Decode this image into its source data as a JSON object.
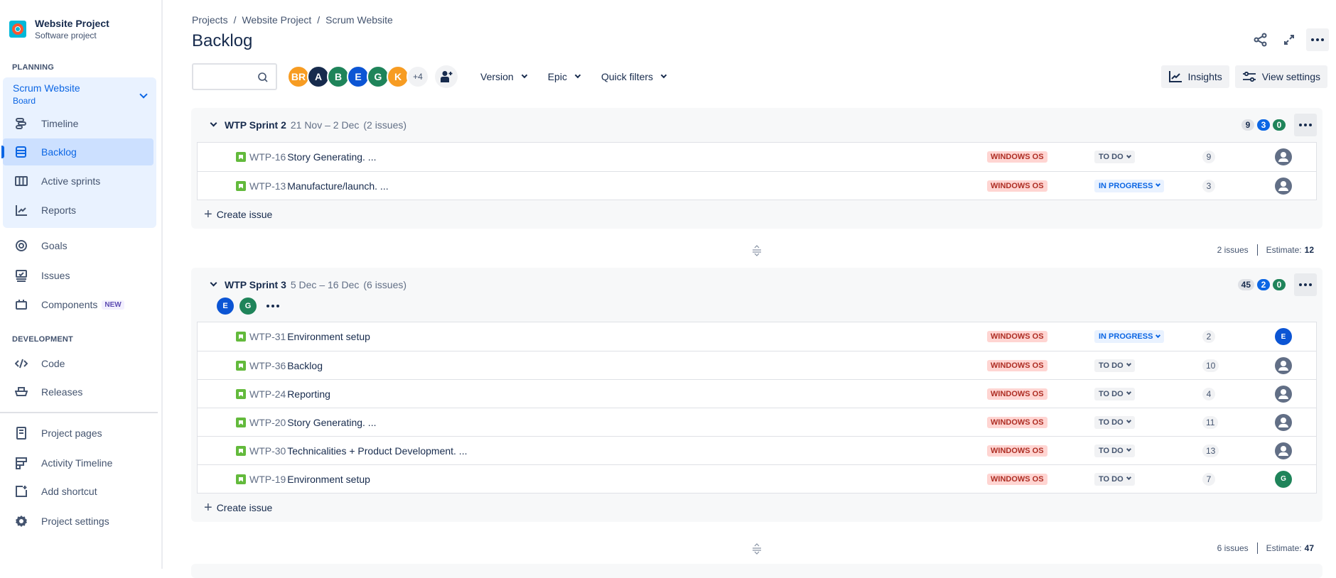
{
  "project": {
    "name": "Website Project",
    "type": "Software project",
    "logo_color": "#00b8d9"
  },
  "sidebar": {
    "planning_heading": "PLANNING",
    "board": {
      "name": "Scrum Website",
      "type": "Board"
    },
    "board_items": [
      {
        "label": "Timeline",
        "icon": "timeline-icon",
        "active": false
      },
      {
        "label": "Backlog",
        "icon": "backlog-icon",
        "active": true
      },
      {
        "label": "Active sprints",
        "icon": "board-columns-icon",
        "active": false
      },
      {
        "label": "Reports",
        "icon": "reports-chart-icon",
        "active": false
      }
    ],
    "items": [
      {
        "label": "Goals",
        "icon": "goals-target-icon"
      },
      {
        "label": "Issues",
        "icon": "issues-icon"
      },
      {
        "label": "Components",
        "icon": "components-icon",
        "badge": "NEW"
      }
    ],
    "development_heading": "DEVELOPMENT",
    "dev_items": [
      {
        "label": "Code",
        "icon": "code-icon"
      },
      {
        "label": "Releases",
        "icon": "releases-ship-icon"
      }
    ],
    "bottom_items": [
      {
        "label": "Project pages",
        "icon": "page-icon"
      },
      {
        "label": "Activity Timeline",
        "icon": "activity-timeline-icon"
      },
      {
        "label": "Add shortcut",
        "icon": "add-shortcut-icon"
      },
      {
        "label": "Project settings",
        "icon": "gear-icon"
      }
    ]
  },
  "breadcrumbs": [
    "Projects",
    "Website Project",
    "Scrum Website"
  ],
  "page_title": "Backlog",
  "toolbar": {
    "search_value": "",
    "search_placeholder": "",
    "avatars": [
      {
        "initials": "BR",
        "color": "#f79c22"
      },
      {
        "initials": "A",
        "color": "#172b4d"
      },
      {
        "initials": "B",
        "color": "#1f845a"
      },
      {
        "initials": "E",
        "color": "#0c55d4"
      },
      {
        "initials": "G",
        "color": "#1f845a"
      },
      {
        "initials": "K",
        "color": "#f79c22"
      }
    ],
    "more_avatars": "+4",
    "filters": [
      "Version",
      "Epic",
      "Quick filters"
    ],
    "insights_label": "Insights",
    "view_settings_label": "View settings"
  },
  "sprints": [
    {
      "name": "WTP Sprint 2",
      "dates": "21 Nov – 2 Dec",
      "issue_count_label": "(2 issues)",
      "counts": {
        "todo": "9",
        "in_progress": "3",
        "done": "0"
      },
      "assignees": [],
      "issues": [
        {
          "key": "WTP-16",
          "summary": "Story Generating. ...",
          "epic": "WINDOWS OS",
          "status": "TO DO",
          "status_type": "todo",
          "estimate": "9",
          "assignee": null
        },
        {
          "key": "WTP-13",
          "summary": "Manufacture/launch. ...",
          "epic": "WINDOWS OS",
          "status": "IN PROGRESS",
          "status_type": "prog",
          "estimate": "3",
          "assignee": null
        }
      ],
      "create_label": "Create issue",
      "footer": {
        "issues": "2 issues",
        "estimate_label": "Estimate:",
        "estimate": "12"
      }
    },
    {
      "name": "WTP Sprint 3",
      "dates": "5 Dec – 16 Dec",
      "issue_count_label": "(6 issues)",
      "counts": {
        "todo": "45",
        "in_progress": "2",
        "done": "0"
      },
      "assignees": [
        {
          "initials": "E",
          "color": "#0c55d4"
        },
        {
          "initials": "G",
          "color": "#1f845a"
        }
      ],
      "issues": [
        {
          "key": "WTP-31",
          "summary": "Environment setup",
          "epic": "WINDOWS OS",
          "status": "IN PROGRESS",
          "status_type": "prog",
          "estimate": "2",
          "assignee": {
            "initials": "E",
            "color": "#0c55d4"
          }
        },
        {
          "key": "WTP-36",
          "summary": "Backlog",
          "epic": "WINDOWS OS",
          "status": "TO DO",
          "status_type": "todo",
          "estimate": "10",
          "assignee": null
        },
        {
          "key": "WTP-24",
          "summary": "Reporting",
          "epic": "WINDOWS OS",
          "status": "TO DO",
          "status_type": "todo",
          "estimate": "4",
          "assignee": null
        },
        {
          "key": "WTP-20",
          "summary": "Story Generating. ...",
          "epic": "WINDOWS OS",
          "status": "TO DO",
          "status_type": "todo",
          "estimate": "11",
          "assignee": null
        },
        {
          "key": "WTP-30",
          "summary": "Technicalities + Product Development. ...",
          "epic": "WINDOWS OS",
          "status": "TO DO",
          "status_type": "todo",
          "estimate": "13",
          "assignee": null
        },
        {
          "key": "WTP-19",
          "summary": "Environment setup",
          "epic": "WINDOWS OS",
          "status": "TO DO",
          "status_type": "todo",
          "estimate": "7",
          "assignee": {
            "initials": "G",
            "color": "#1f845a"
          }
        }
      ],
      "create_label": "Create issue",
      "footer": {
        "issues": "6 issues",
        "estimate_label": "Estimate:",
        "estimate": "47"
      }
    }
  ],
  "colors": {
    "accent": "#0c66e4",
    "story": "#63ba3c",
    "epic_bg": "#ffd5d2",
    "epic_text": "#ae2e24",
    "done": "#1f845a"
  }
}
